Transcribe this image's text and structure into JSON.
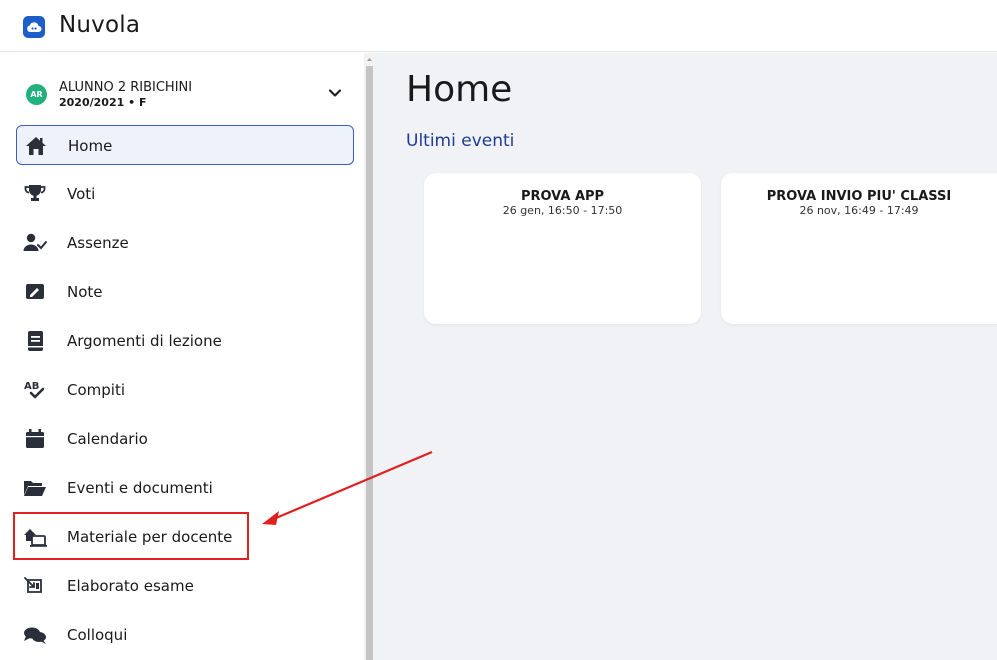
{
  "app": {
    "title": "Nuvola"
  },
  "user": {
    "initials": "AR",
    "name": "ALUNNO 2 RIBICHINI",
    "subtitle": "2020/2021 • F"
  },
  "sidebar": {
    "items": [
      {
        "label": "Home",
        "icon": "home-icon",
        "active": true
      },
      {
        "label": "Voti",
        "icon": "trophy-icon"
      },
      {
        "label": "Assenze",
        "icon": "user-check-icon"
      },
      {
        "label": "Note",
        "icon": "note-icon"
      },
      {
        "label": "Argomenti di lezione",
        "icon": "book-icon"
      },
      {
        "label": "Compiti",
        "icon": "spellcheck-icon"
      },
      {
        "label": "Calendario",
        "icon": "calendar-icon"
      },
      {
        "label": "Eventi e documenti",
        "icon": "folder-open-icon"
      },
      {
        "label": "Materiale per docente",
        "icon": "teacher-material-icon"
      },
      {
        "label": "Elaborato esame",
        "icon": "exam-icon"
      },
      {
        "label": "Colloqui",
        "icon": "chat-icon"
      }
    ]
  },
  "main": {
    "title": "Home",
    "section": "Ultimi eventi",
    "events": [
      {
        "title": "PROVA APP",
        "time": "26 gen, 16:50 - 17:50"
      },
      {
        "title": "PROVA INVIO PIU' CLASSI",
        "time": "26 nov, 16:49 - 17:49"
      }
    ]
  },
  "colors": {
    "brand": "#1d5ec9",
    "avatar": "#22b07d",
    "active_border": "#3a5dbf",
    "section_title": "#1f3a93",
    "annotation": "#e02020"
  }
}
